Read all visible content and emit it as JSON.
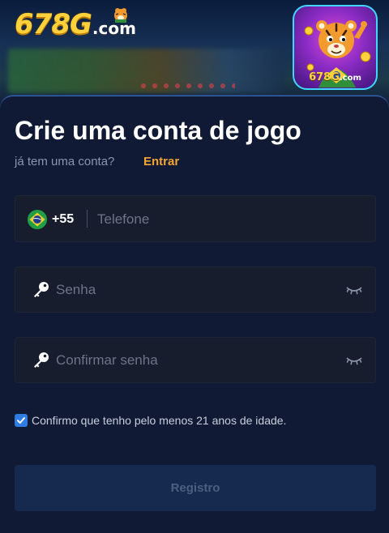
{
  "header": {
    "logo_number": "678G",
    "logo_domain": ".com",
    "app_icon_number": "678G",
    "app_icon_domain": ".com"
  },
  "form": {
    "title": "Crie uma conta de jogo",
    "subtitle": "já tem uma conta?",
    "login_link": "Entrar",
    "phone": {
      "country_code": "+55",
      "placeholder": "Telefone",
      "flag_icon": "brazil-flag-icon"
    },
    "password": {
      "placeholder": "Senha",
      "icon": "key-icon",
      "toggle_icon": "eye-closed-icon"
    },
    "confirm_password": {
      "placeholder": "Confirmar senha",
      "icon": "key-icon",
      "toggle_icon": "eye-closed-icon"
    },
    "age_confirmation": {
      "label": "Confirmo que tenho pelo menos 21 anos de idade.",
      "checked": true
    },
    "submit_label": "Registro"
  },
  "colors": {
    "background": "#111a35",
    "accent_link": "#f3a633",
    "checkbox": "#2f7de1",
    "button": "#152a4e"
  }
}
